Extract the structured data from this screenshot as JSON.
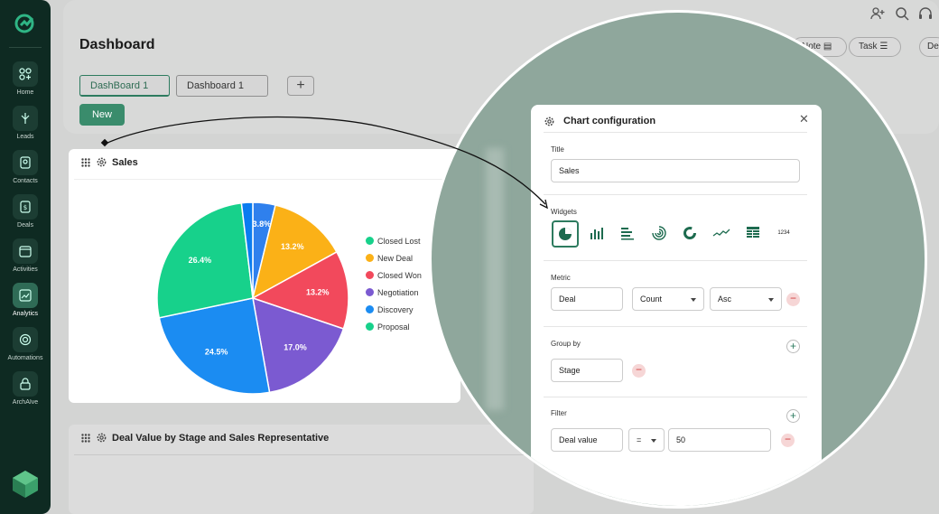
{
  "sidebar": {
    "items": [
      {
        "label": "Home",
        "icon": "home-icon"
      },
      {
        "label": "Leads",
        "icon": "leads-icon"
      },
      {
        "label": "Contacts",
        "icon": "contacts-icon"
      },
      {
        "label": "Deals",
        "icon": "deals-icon"
      },
      {
        "label": "Activities",
        "icon": "activities-icon"
      },
      {
        "label": "Analytics",
        "icon": "analytics-icon",
        "active": true
      },
      {
        "label": "Automations",
        "icon": "automations-icon"
      },
      {
        "label": "ArchAIve",
        "icon": "archive-icon"
      }
    ]
  },
  "header": {
    "title": "Dashboard",
    "tabs": [
      "DashBoard 1",
      "Dashboard 1"
    ],
    "add_tab": "+",
    "new_button": "New",
    "note_button": "Note",
    "task_button": "Task",
    "demo_button": "Der"
  },
  "sales_card": {
    "title": "Sales",
    "chart_data": {
      "type": "pie",
      "slices": [
        {
          "label": "3.8%",
          "value": 3.8,
          "color": "#2f80ed"
        },
        {
          "label": "13.2%",
          "value": 13.2,
          "color": "#fbb117"
        },
        {
          "label": "13.2%",
          "value": 13.2,
          "color": "#f2495c"
        },
        {
          "label": "17.0%",
          "value": 17.0,
          "color": "#7b5ad1"
        },
        {
          "label": "24.5%",
          "value": 24.5,
          "color": "#1b8cf2"
        },
        {
          "label": "26.4%",
          "value": 26.4,
          "color": "#17d18b"
        },
        {
          "label": "",
          "value": 1.9,
          "color": "#0a7cf0"
        }
      ],
      "legend": [
        {
          "name": "Closed Lost",
          "color": "#17d18b"
        },
        {
          "name": "New Deal",
          "color": "#fbb117"
        },
        {
          "name": "Closed Won",
          "color": "#f2495c"
        },
        {
          "name": "Negotiation",
          "color": "#7b5ad1"
        },
        {
          "name": "Discovery",
          "color": "#1b8cf2"
        },
        {
          "name": "Proposal",
          "color": "#17d18b"
        }
      ],
      "legend_position": "right"
    }
  },
  "deal_card": {
    "title": "Deal Value by Stage and Sales Representative"
  },
  "chart_config": {
    "title": "Chart configuration",
    "close": "✕",
    "title_label": "Title",
    "title_value": "Sales",
    "widgets_label": "Widgets",
    "widgets": [
      "pie-chart-icon",
      "bar-chart-icon",
      "horizontal-bar-icon",
      "radial-bar-icon",
      "donut-chart-icon",
      "line-chart-icon",
      "table-icon",
      "number-icon"
    ],
    "number_widget_text": "1234",
    "metric_label": "Metric",
    "metric_field": "Deal",
    "metric_agg": "Count",
    "metric_sort": "Asc",
    "groupby_label": "Group by",
    "groupby_field": "Stage",
    "filter_label": "Filter",
    "filter_field": "Deal value",
    "filter_op": "=",
    "filter_value": "50"
  }
}
